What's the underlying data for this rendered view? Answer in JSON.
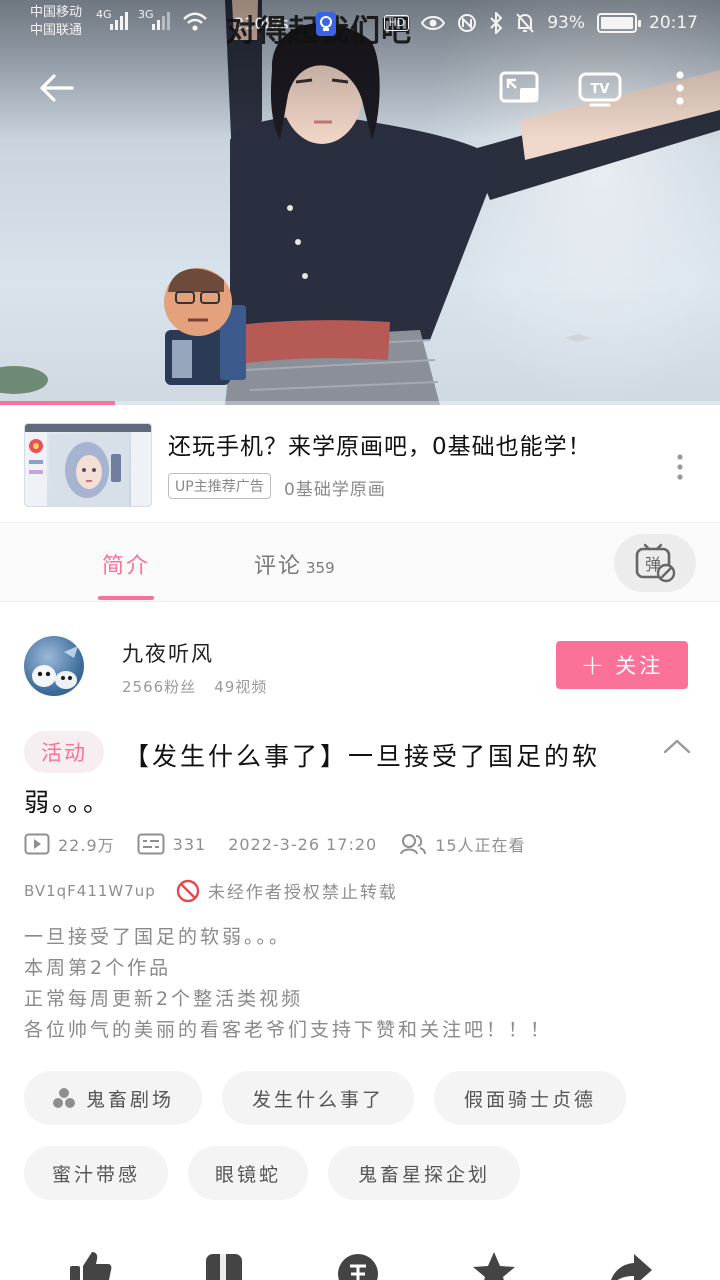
{
  "status_bar": {
    "carrier_1": "中国移动",
    "carrier_2": "中国联通",
    "net_1": "4G",
    "net_2": "3G",
    "speed": "210K/s",
    "hd": "HD",
    "battery_percent": "93%",
    "time": "20:17"
  },
  "player": {
    "danmaku_text": "对得起我们吧",
    "progress_fraction": 0.16,
    "accent_color": "#fb7299"
  },
  "ad": {
    "title": "还玩手机？来学原画吧，0基础也能学！",
    "badge": "UP主推荐广告",
    "subtitle": "0基础学原画"
  },
  "tabs": {
    "intro": "简介",
    "comments": "评论",
    "comments_count": "359",
    "danmaku_toggle_glyph": "弹"
  },
  "uploader": {
    "name": "九夜听风",
    "fans": "2566粉丝",
    "videos": "49视频",
    "follow_label": "关注"
  },
  "video": {
    "activity_tag": "活动",
    "title": "【发生什么事了】一旦接受了国足的软弱。。。",
    "views": "22.9万",
    "danmaku_count": "331",
    "date": "2022-3-26 17:20",
    "watching": "15人正在看",
    "bvid": "BV1qF411W7up",
    "copyright_notice": "未经作者授权禁止转载",
    "description": [
      "一旦接受了国足的软弱。。。",
      "本周第2个作品",
      "正常每周更新2个整活类视频",
      "各位帅气的美丽的看客老爷们支持下赞和关注吧！！！"
    ]
  },
  "tags": [
    "鬼畜剧场",
    "发生什么事了",
    "假面骑士贞德",
    "蜜汁带感",
    "眼镜蛇",
    "鬼畜星探企划"
  ]
}
